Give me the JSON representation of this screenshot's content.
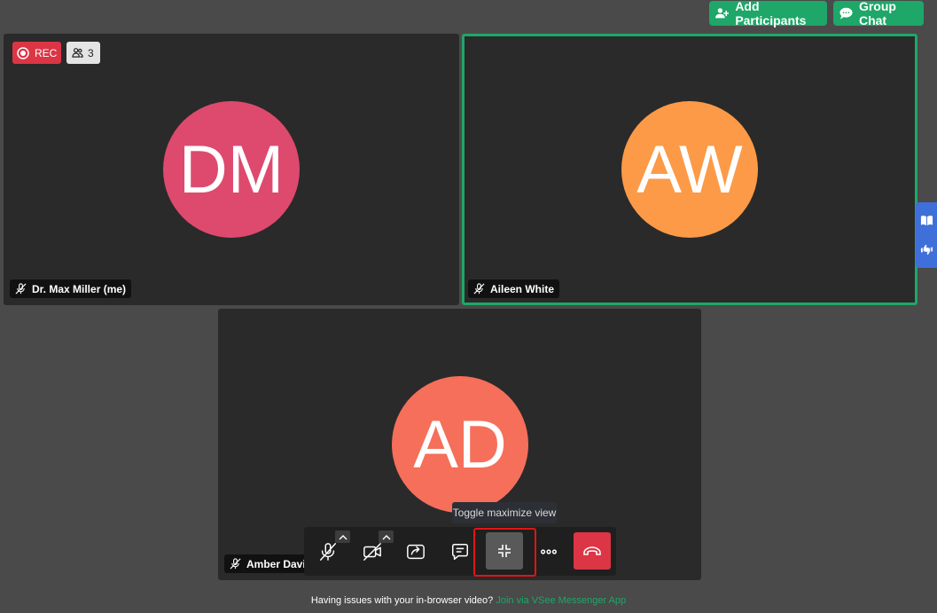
{
  "header": {
    "add_participants_label": "Add Participants",
    "group_chat_label": "Group Chat"
  },
  "badges": {
    "rec_label": "REC",
    "participant_count": "3"
  },
  "participants": [
    {
      "initials": "DM",
      "name": "Dr. Max Miller (me)",
      "color": "#dd4a6e",
      "mic": "muted"
    },
    {
      "initials": "AW",
      "name": "Aileen White",
      "color": "#fc9a47",
      "mic": "muted",
      "active_speaker": true
    },
    {
      "initials": "AD",
      "name": "Amber Davis",
      "color": "#f56f5a",
      "mic": "muted"
    }
  ],
  "toolbar": {
    "tooltip": "Toggle maximize view",
    "buttons": [
      "mic-off-icon",
      "video-off-icon",
      "share-screen-icon",
      "chat-icon",
      "minimize-icon",
      "more-icon",
      "hang-up-icon"
    ]
  },
  "side_panel": {
    "icons": [
      "book-icon",
      "thumbs-feedback-icon"
    ]
  },
  "footer": {
    "text": "Having issues with your in-browser video?",
    "link_text": "Join via VSee Messenger App"
  },
  "colors": {
    "accent": "#1ea768",
    "danger": "#dc3545",
    "background": "#4a4a4a",
    "tile": "#2a2a2a"
  }
}
